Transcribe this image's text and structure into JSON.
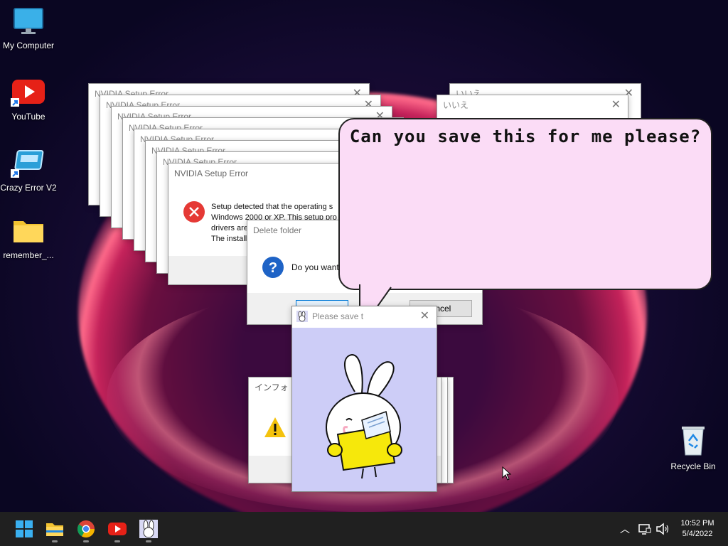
{
  "desktop": {
    "icons": [
      {
        "label": "My Computer"
      },
      {
        "label": "YouTube"
      },
      {
        "label": "Crazy Error V2"
      },
      {
        "label": "remember_..."
      },
      {
        "label": "Recycle Bin"
      }
    ]
  },
  "nvidia_errors": {
    "title": "NVIDIA Setup Error",
    "message_lines": [
      "Setup detected that the operating s",
      "Windows 2000 or XP. This setup pro",
      "drivers are",
      "The install"
    ]
  },
  "jp_windows": {
    "title_a": "いいえ",
    "title_b": "いいえ"
  },
  "delete_folder": {
    "title": "Delete folder",
    "message": "Do you want t",
    "cancel_label": "ancel"
  },
  "info_window": {
    "title": "インフォ"
  },
  "bunny_window": {
    "title": "Please save t"
  },
  "bubble": {
    "text": "Can you save this for me please?"
  },
  "taskbar": {
    "time": "10:52 PM",
    "date": "5/4/2022"
  },
  "colors": {
    "taskbar_bg": "#202020",
    "bubble_fill": "#fbdcf6",
    "bunny_bg": "#cdcdf7",
    "error_red": "#e53935",
    "question_blue": "#1e63c6",
    "warning_yellow": "#f4c20d"
  }
}
